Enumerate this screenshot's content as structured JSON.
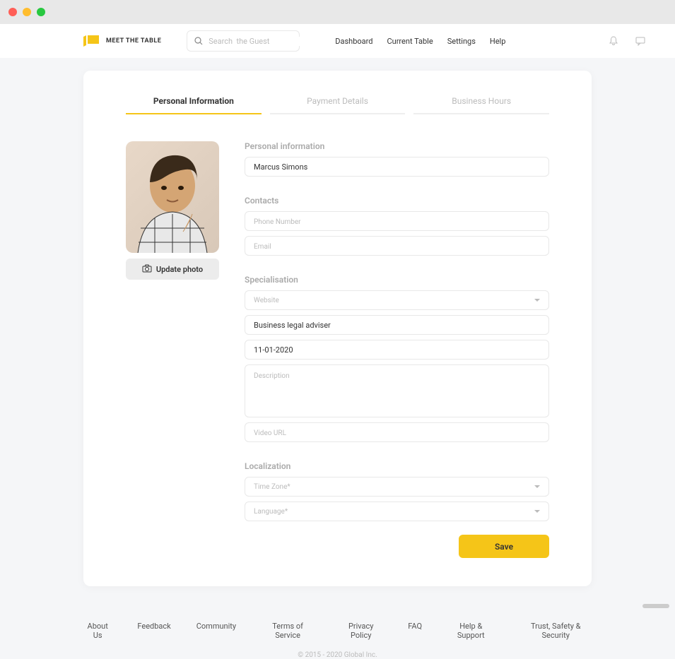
{
  "logo_text": "MEET THE TABLE",
  "search": {
    "placeholder": "Search  the Guest"
  },
  "nav": [
    "Dashboard",
    "Current Table",
    "Settings",
    "Help"
  ],
  "tabs": [
    {
      "label": "Personal Information",
      "active": true
    },
    {
      "label": "Payment Details",
      "active": false
    },
    {
      "label": "Business Hours",
      "active": false
    }
  ],
  "update_photo_label": "Update photo",
  "sections": {
    "personal": {
      "label": "Personal information",
      "name_value": "Marcus Simons"
    },
    "contacts": {
      "label": "Contacts",
      "phone_placeholder": "Phone Number",
      "email_placeholder": "Email"
    },
    "specialisation": {
      "label": "Specialisation",
      "website_placeholder": "Website",
      "title_value": "Business legal adviser",
      "date_value": "11-01-2020",
      "description_placeholder": "Description",
      "video_placeholder": "Video URL"
    },
    "localization": {
      "label": "Localization",
      "timezone_placeholder": "Time Zone*",
      "language_placeholder": "Language*"
    }
  },
  "save_label": "Save",
  "footer_links": [
    "About Us",
    "Feedback",
    "Community",
    "Terms of Service",
    "Privacy Policy",
    "FAQ",
    "Help & Support",
    "Trust, Safety & Security"
  ],
  "copyright": "© 2015 - 2020 Global Inc."
}
